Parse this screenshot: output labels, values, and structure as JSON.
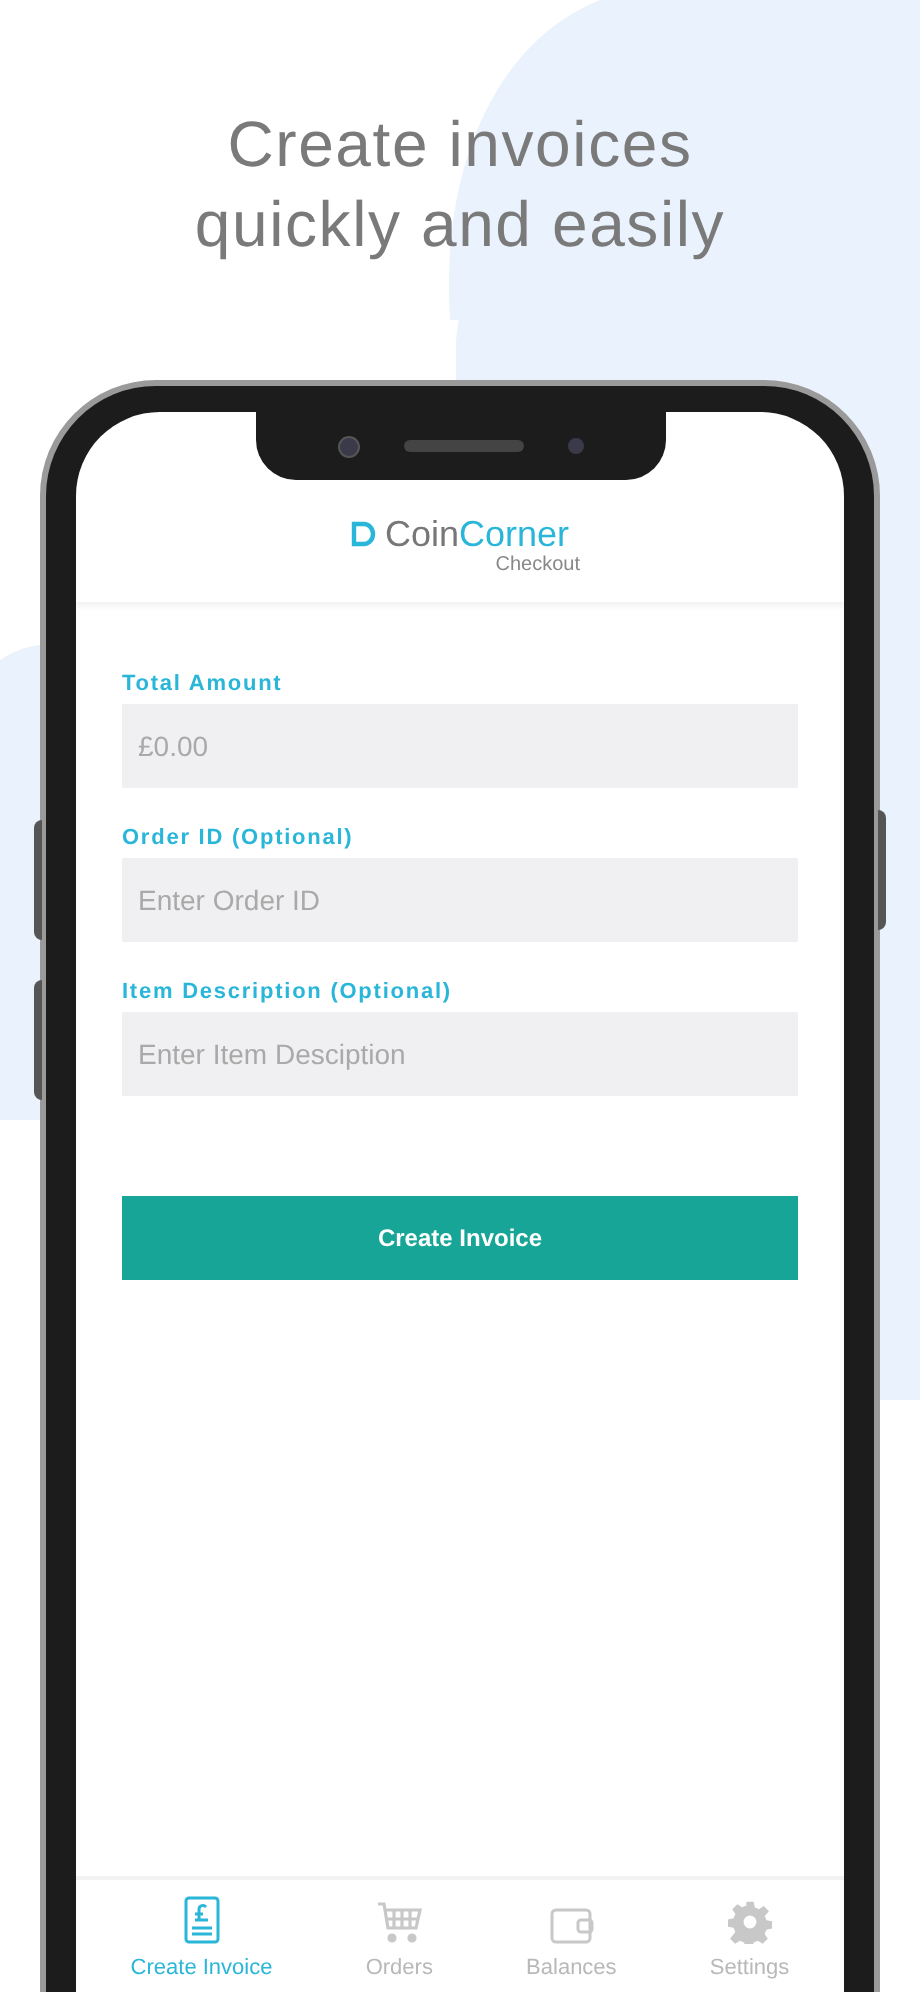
{
  "headline": "Create invoices quickly and easily",
  "header": {
    "logo_first": "Coin",
    "logo_second": "Corner",
    "subtitle": "Checkout"
  },
  "fields": [
    {
      "label": "Total Amount",
      "placeholder": "£0.00"
    },
    {
      "label": "Order ID (Optional)",
      "placeholder": "Enter Order ID"
    },
    {
      "label": "Item Description (Optional)",
      "placeholder": "Enter Item Desciption"
    }
  ],
  "button": "Create Invoice",
  "tabs": [
    {
      "kind": "invoice",
      "label": "Create Invoice",
      "selected": true
    },
    {
      "kind": "cart",
      "label": "Orders",
      "selected": false
    },
    {
      "kind": "wallet",
      "label": "Balances",
      "selected": false
    },
    {
      "kind": "gear",
      "label": "Settings",
      "selected": false
    }
  ]
}
